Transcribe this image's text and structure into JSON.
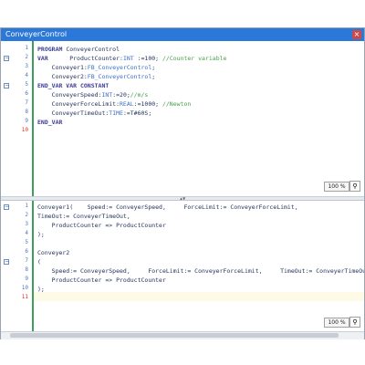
{
  "window": {
    "title": "ConveyerControl",
    "close_icon": "close-icon"
  },
  "top_pane": {
    "line_numbers": [
      "1",
      "2",
      "3",
      "4",
      "5",
      "6",
      "7",
      "8",
      "9",
      "10"
    ],
    "lines": [
      [
        {
          "t": "PROGRAM ",
          "c": "kw"
        },
        {
          "t": "ConveyerControl",
          "c": ""
        }
      ],
      [
        {
          "t": "VAR      ",
          "c": "kw"
        },
        {
          "t": "ProductCounter:",
          "c": ""
        },
        {
          "t": "INT",
          "c": "ty"
        },
        {
          "t": " :=100; ",
          "c": ""
        },
        {
          "t": "//Counter variable",
          "c": "cm"
        }
      ],
      [
        {
          "t": "    Conveyer1:",
          "c": ""
        },
        {
          "t": "FB_ConveyerControl",
          "c": "ty"
        },
        {
          "t": ";",
          "c": ""
        }
      ],
      [
        {
          "t": "    Conveyer2:",
          "c": ""
        },
        {
          "t": "FB_ConveyerControl",
          "c": "ty"
        },
        {
          "t": ";",
          "c": ""
        }
      ],
      [
        {
          "t": "END_VAR VAR CONSTANT",
          "c": "kw"
        }
      ],
      [
        {
          "t": "    ConveyerSpeed:",
          "c": ""
        },
        {
          "t": "INT",
          "c": "ty"
        },
        {
          "t": ":=20;",
          "c": ""
        },
        {
          "t": "//m/s",
          "c": "cm"
        }
      ],
      [
        {
          "t": "    ConveyerForceLimit:",
          "c": ""
        },
        {
          "t": "REAL",
          "c": "ty"
        },
        {
          "t": ":=1000; ",
          "c": ""
        },
        {
          "t": "//Newton",
          "c": "cm"
        }
      ],
      [
        {
          "t": "    ConveyerTimeOut:",
          "c": ""
        },
        {
          "t": "TIME",
          "c": "ty"
        },
        {
          "t": ":=T#60S;",
          "c": ""
        }
      ],
      [
        {
          "t": "END_VAR",
          "c": "kw"
        }
      ],
      [
        {
          "t": "",
          "c": ""
        }
      ]
    ],
    "zoom": "100 %"
  },
  "bottom_pane": {
    "line_numbers": [
      "1",
      "2",
      "3",
      "4",
      "5",
      "6",
      "7",
      "8",
      "9",
      "10",
      "11"
    ],
    "lines": [
      [
        {
          "t": "Conveyer1(    Speed:= ConveyerSpeed,     ForceLimit:= ConveyerForceLimit,",
          "c": ""
        }
      ],
      [
        {
          "t": "TimeOut:= ConveyerTimeOut,",
          "c": ""
        }
      ],
      [
        {
          "t": "    ProductCounter => ProductCounter",
          "c": ""
        }
      ],
      [
        {
          "t": ");",
          "c": ""
        }
      ],
      [
        {
          "t": "",
          "c": ""
        }
      ],
      [
        {
          "t": "Conveyer2",
          "c": ""
        }
      ],
      [
        {
          "t": "(",
          "c": ""
        }
      ],
      [
        {
          "t": "    Speed:= ConveyerSpeed,     ForceLimit:= ConveyerForceLimit,     TimeOut:= ConveyerTimeOut,",
          "c": ""
        }
      ],
      [
        {
          "t": "    ProductCounter => ProductCounter",
          "c": ""
        }
      ],
      [
        {
          "t": ");",
          "c": ""
        }
      ],
      [
        {
          "t": "",
          "c": ""
        }
      ]
    ],
    "zoom": "100 %"
  }
}
